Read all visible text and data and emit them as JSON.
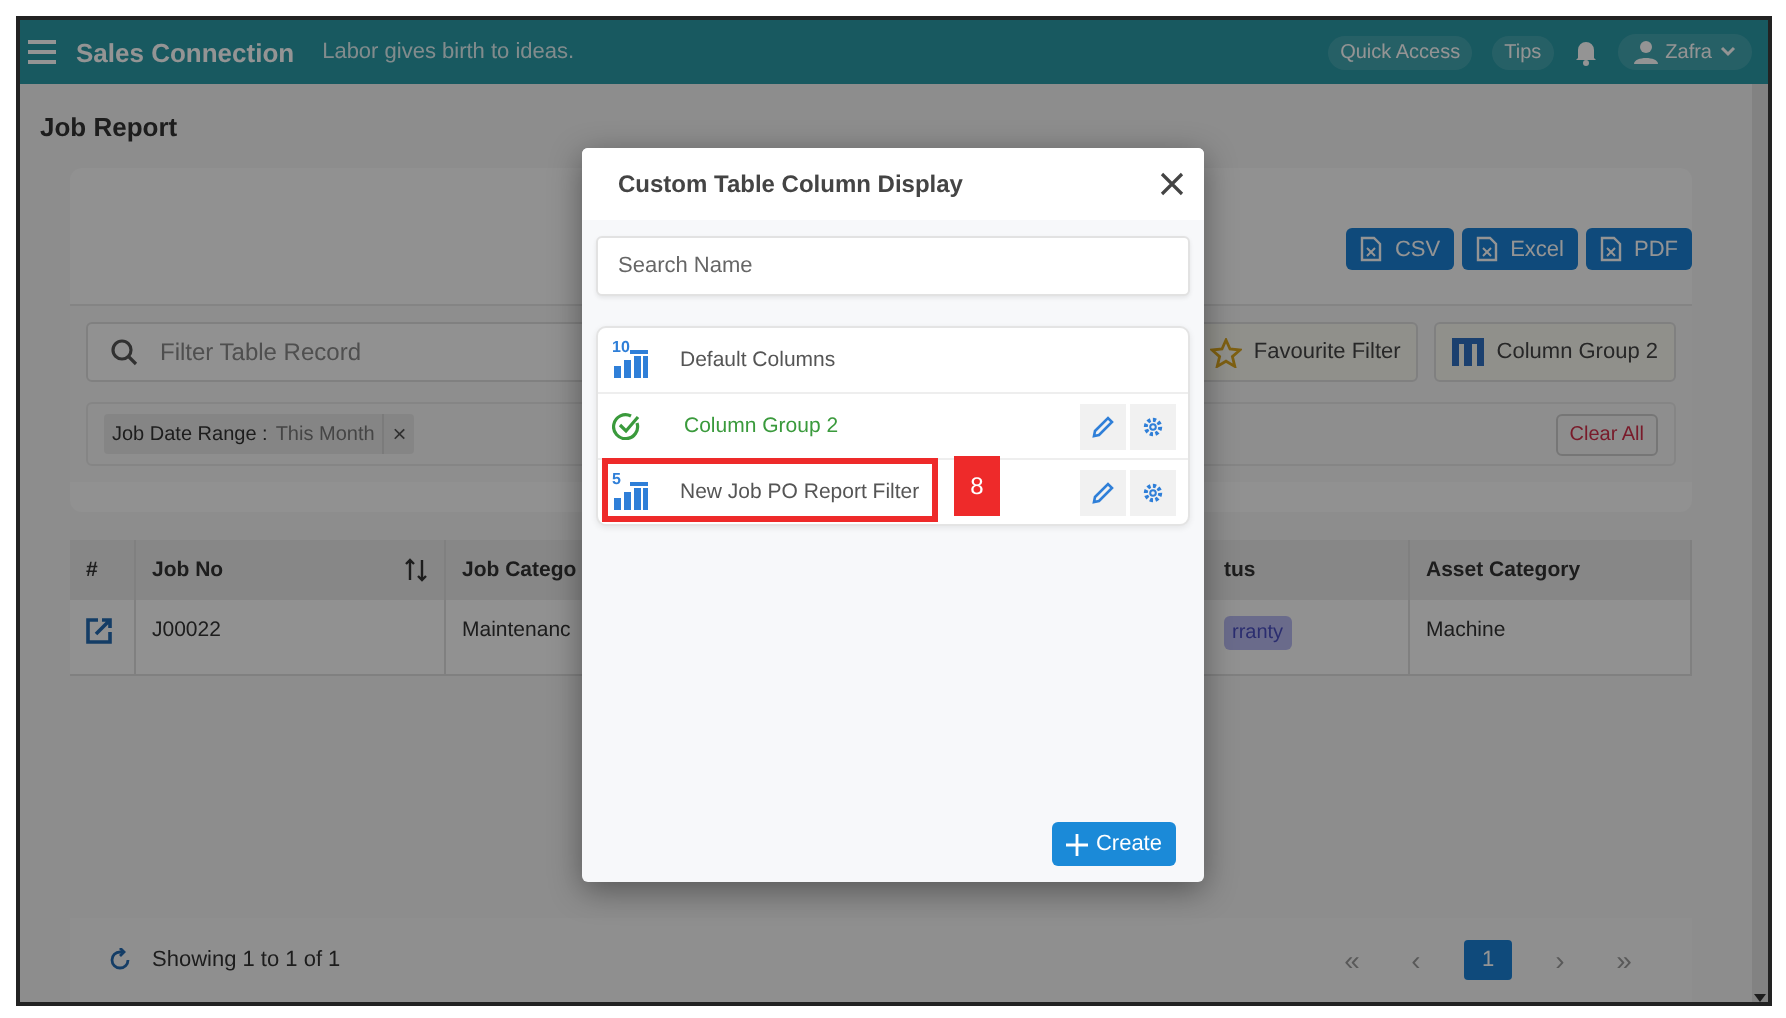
{
  "header": {
    "title": "Sales Connection",
    "tagline": "Labor gives birth to ideas.",
    "links": [
      "Quick Access",
      "Tips"
    ],
    "user": "Zafra"
  },
  "page": {
    "title": "Job Report"
  },
  "exports": [
    "CSV",
    "Excel",
    "PDF"
  ],
  "filter": {
    "placeholder": "Filter Table Record",
    "buttons": [
      {
        "kind": "favourite",
        "label": "Favourite Filter"
      },
      {
        "kind": "columns",
        "label": "Column Group 2"
      }
    ]
  },
  "chips": [
    {
      "label": "Job Date Range :",
      "value": "This Month",
      "remove": "×"
    }
  ],
  "clear_all": "Clear All",
  "table": {
    "columns": [
      "#",
      "Job No",
      "Job Catego",
      "tus",
      "Asset Category"
    ],
    "rows": [
      {
        "job_no": "J00022",
        "category": "Maintenanc",
        "status": "rranty",
        "asset_category": "Machine"
      }
    ]
  },
  "footer": {
    "summary": "Showing 1 to 1 of 1",
    "pager": [
      {
        "label": "«",
        "selected": false
      },
      {
        "label": "‹",
        "selected": false
      },
      {
        "label": "1",
        "selected": true
      },
      {
        "label": "›",
        "selected": false
      },
      {
        "label": "»",
        "selected": false
      }
    ]
  },
  "dialog": {
    "title": "Custom Table Column Display",
    "search_placeholder": "Search Name",
    "items": [
      {
        "name": "Default Columns",
        "count": "10",
        "selected": false,
        "editable": false
      },
      {
        "name": "Column Group 2",
        "selected": true,
        "editable": true
      },
      {
        "name": "New Job PO Report Filter",
        "count": "5",
        "selected": false,
        "editable": true,
        "callout": "8"
      }
    ],
    "create": "Create"
  }
}
